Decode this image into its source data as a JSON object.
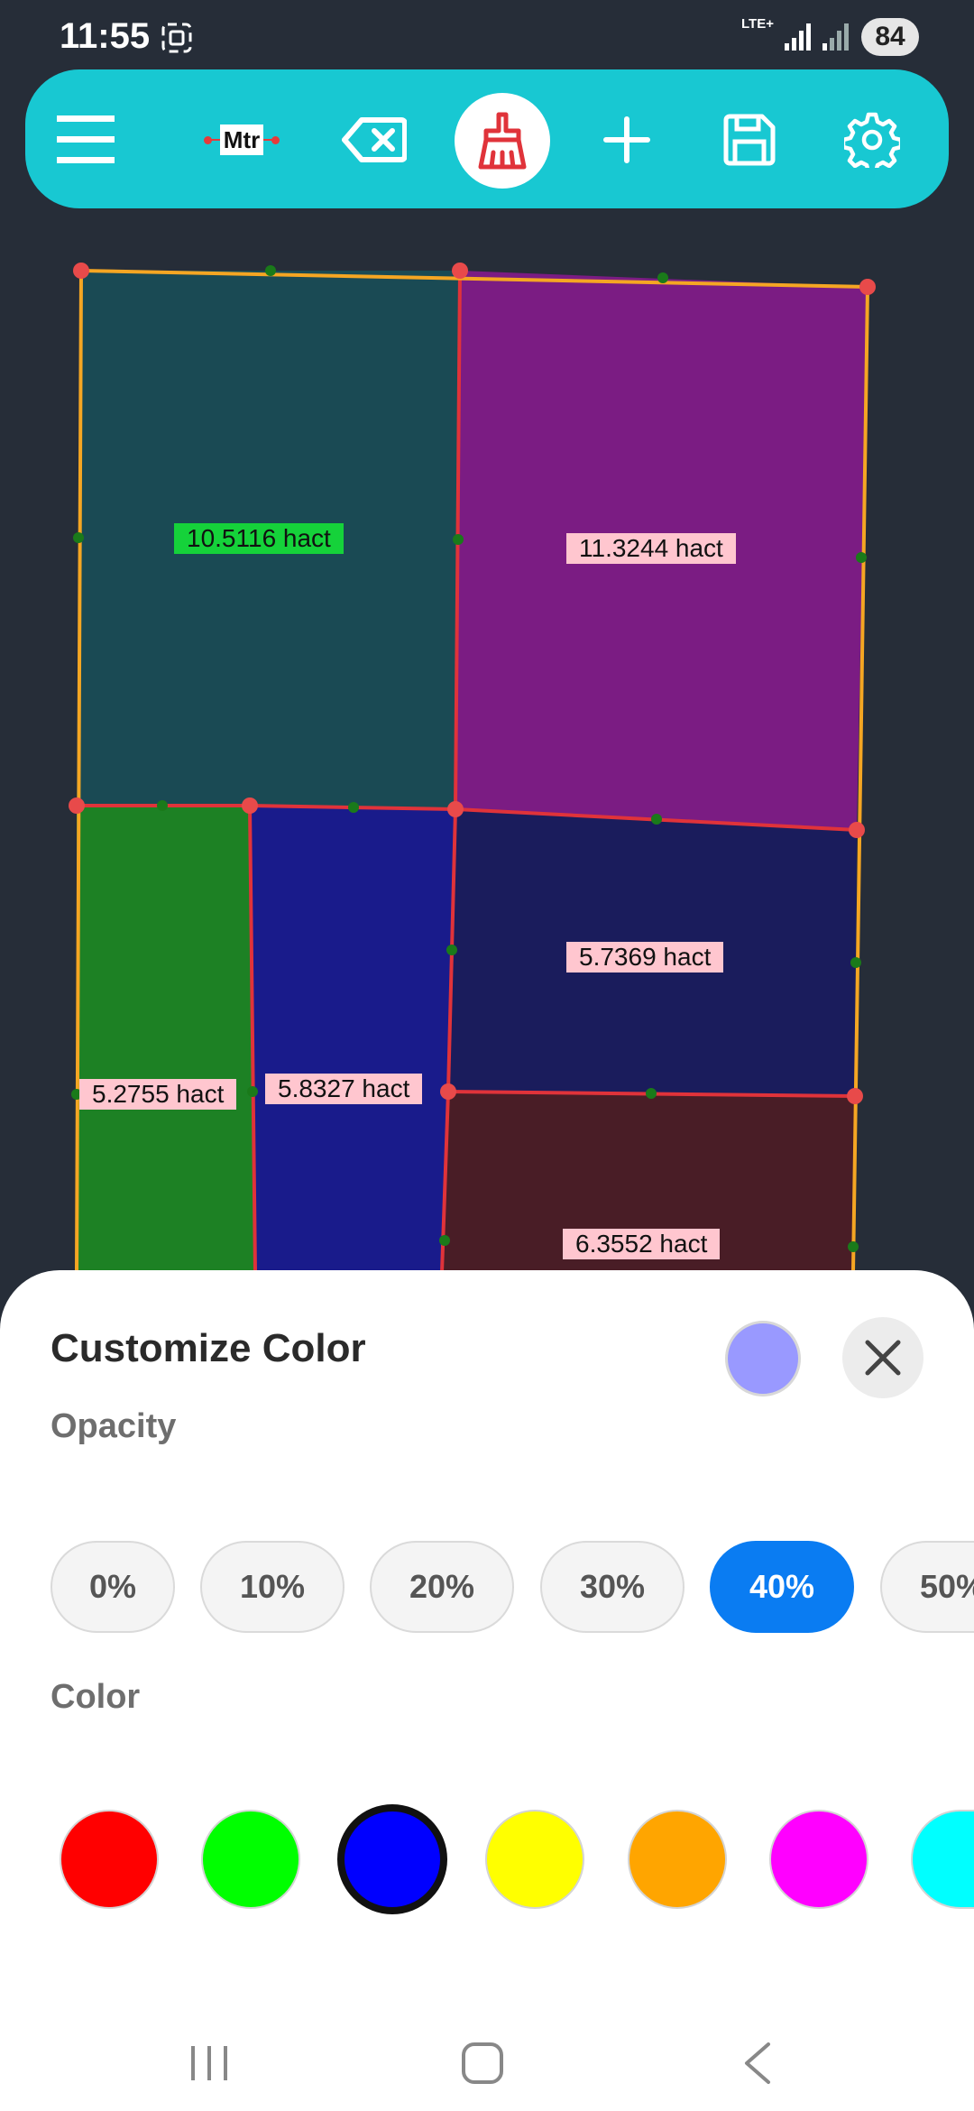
{
  "status": {
    "time": "11:55",
    "network": "LTE+",
    "battery": "84"
  },
  "toolbar": {
    "unit_label": "Mtr"
  },
  "parcels": [
    {
      "name": "parcel-top-left",
      "area": "10.5116 hact",
      "fill": "#1a4a54",
      "label_bg": "#15d23a"
    },
    {
      "name": "parcel-top-right",
      "area": "11.3244 hact",
      "fill": "#7b1c83",
      "label_bg": "#ffc6cf"
    },
    {
      "name": "parcel-mid-right",
      "area": "5.7369 hact",
      "fill": "#1a1c5c",
      "label_bg": "#ffc6cf"
    },
    {
      "name": "parcel-bottom-left",
      "area": "5.2755 hact",
      "fill": "#1d8124",
      "label_bg": "#ffc6cf"
    },
    {
      "name": "parcel-bottom-mid",
      "area": "5.8327 hact",
      "fill": "#191b8b",
      "label_bg": "#ffc6cf"
    },
    {
      "name": "parcel-bottom-right",
      "area": "6.3552 hact",
      "fill": "#491d26",
      "label_bg": "#ffc6cf"
    }
  ],
  "colors": {
    "boundary_outer": "#f5a623",
    "boundary_inner": "#e0333a",
    "accent": "#18c8d2",
    "selected": "#0a7cf2"
  },
  "sheet": {
    "title": "Customize Color",
    "opacity_label": "Opacity",
    "opacity_options": [
      "0%",
      "10%",
      "20%",
      "30%",
      "40%",
      "50%"
    ],
    "opacity_selected": "40%",
    "color_label": "Color",
    "color_options": [
      {
        "name": "red",
        "hex": "#ff0000"
      },
      {
        "name": "green",
        "hex": "#00ff00"
      },
      {
        "name": "blue",
        "hex": "#0000ff"
      },
      {
        "name": "yellow",
        "hex": "#ffff00"
      },
      {
        "name": "orange",
        "hex": "#ffa500"
      },
      {
        "name": "magenta",
        "hex": "#ff00ff"
      },
      {
        "name": "cyan",
        "hex": "#00ffff"
      }
    ],
    "color_selected": "blue"
  }
}
